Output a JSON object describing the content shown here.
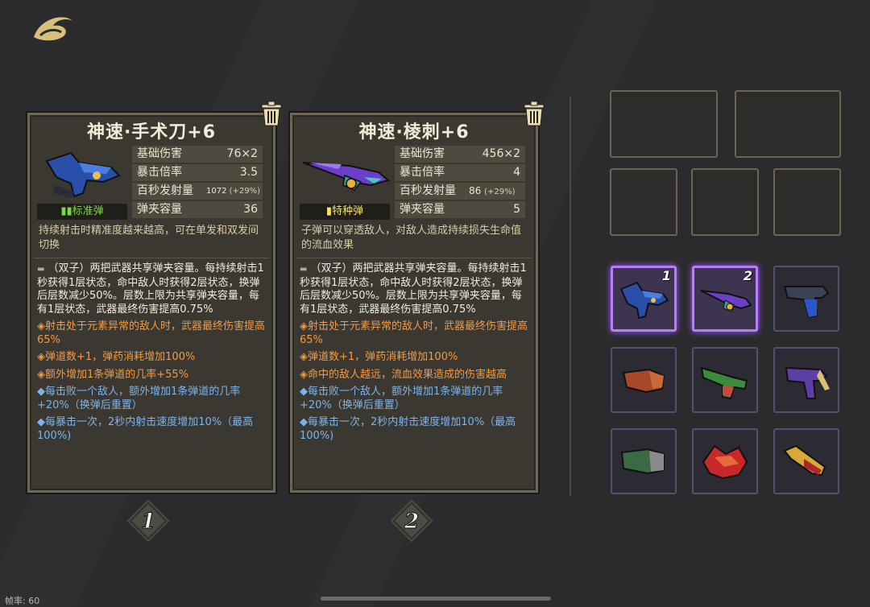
{
  "cards": [
    {
      "title": "神速·手术刀+6",
      "ammo_type": "标准弹",
      "ammo_color": "#7bd84a",
      "stats": [
        {
          "label": "基础伤害",
          "value": "76×2"
        },
        {
          "label": "暴击倍率",
          "value": "3.5"
        },
        {
          "label": "百秒发射量",
          "value": "1072",
          "sub": "(+29%)"
        },
        {
          "label": "弹夹容量",
          "value": "36"
        }
      ],
      "description": "持续射击时精准度越来越高，可在单发和双发间切换",
      "effects": [
        {
          "kind": "white",
          "bullet": "▬",
          "text": "（双子）两把武器共享弹夹容量。每持续射击1秒获得1层状态，命中敌人时获得2层状态，换弹后层数减少50%。层数上限为共享弹夹容量，每有1层状态，武器最终伤害提高0.75%"
        },
        {
          "kind": "orange",
          "bullet": "◈",
          "text": "射击处于元素异常的敌人时，武器最终伤害提高65%"
        },
        {
          "kind": "orange",
          "bullet": "◈",
          "text": "弹道数+1，弹药消耗增加100%"
        },
        {
          "kind": "orange",
          "bullet": "◈",
          "text": "额外增加1条弹道的几率+55%"
        },
        {
          "kind": "blue",
          "bullet": "◆",
          "text": "每击败一个敌人，额外增加1条弹道的几率+20%（换弹后重置）"
        },
        {
          "kind": "blue",
          "bullet": "◆",
          "text": "每暴击一次，2秒内射击速度增加10%（最高100%)"
        }
      ],
      "slot_number": "1"
    },
    {
      "title": "神速·棱刺+6",
      "ammo_type": "特种弹",
      "ammo_color": "#f3e16a",
      "stats": [
        {
          "label": "基础伤害",
          "value": "456×2"
        },
        {
          "label": "暴击倍率",
          "value": "4"
        },
        {
          "label": "百秒发射量",
          "value": "86",
          "sub": "(+29%)"
        },
        {
          "label": "弹夹容量",
          "value": "5"
        }
      ],
      "description": "子弹可以穿透敌人，对敌人造成持续损失生命值的流血效果",
      "effects": [
        {
          "kind": "white",
          "bullet": "▬",
          "text": "（双子）两把武器共享弹夹容量。每持续射击1秒获得1层状态，命中敌人时获得2层状态，换弹后层数减少50%。层数上限为共享弹夹容量，每有1层状态，武器最终伤害提高0.75%"
        },
        {
          "kind": "orange",
          "bullet": "◈",
          "text": "射击处于元素异常的敌人时，武器最终伤害提高65%"
        },
        {
          "kind": "orange",
          "bullet": "◈",
          "text": "弹道数+1，弹药消耗增加100%"
        },
        {
          "kind": "orange",
          "bullet": "◈",
          "text": "命中的敌人越远，流血效果造成的伤害越高"
        },
        {
          "kind": "blue",
          "bullet": "◆",
          "text": "每击败一个敌人，额外增加1条弹道的几率+20%（换弹后重置）"
        },
        {
          "kind": "blue",
          "bullet": "◆",
          "text": "每暴击一次，2秒内射击速度增加10%（最高100%)"
        }
      ],
      "slot_number": "2"
    }
  ],
  "inventory": [
    {
      "weapon": "scalpel-gun-icon",
      "badge": "1",
      "selected": true
    },
    {
      "weapon": "spike-gun-icon",
      "badge": "2",
      "selected": true
    },
    {
      "weapon": "blue-pistol-icon",
      "badge": "",
      "selected": false
    },
    {
      "weapon": "fire-gauntlet-icon",
      "badge": "",
      "selected": false
    },
    {
      "weapon": "green-shotgun-icon",
      "badge": "",
      "selected": false
    },
    {
      "weapon": "purple-smg-icon",
      "badge": "",
      "selected": false
    },
    {
      "weapon": "green-gauntlet-icon",
      "badge": "",
      "selected": false
    },
    {
      "weapon": "red-dragon-icon",
      "badge": "",
      "selected": false
    },
    {
      "weapon": "gold-cannon-icon",
      "badge": "",
      "selected": false
    }
  ],
  "fps_label": "帧率: 60",
  "colors": {
    "accent_purple": "#b97cff",
    "orange": "#f39a43",
    "blue": "#7eb3ea"
  }
}
